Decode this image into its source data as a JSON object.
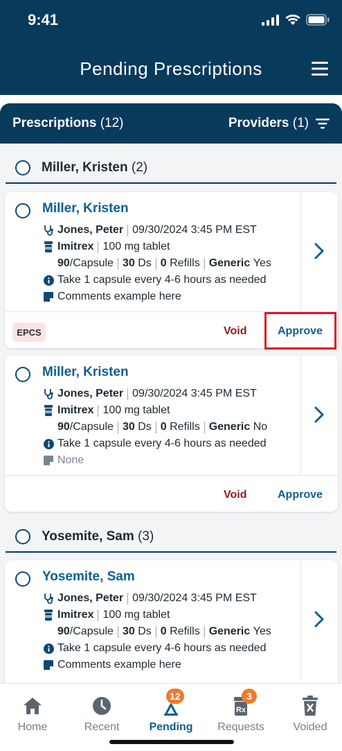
{
  "status": {
    "time": "9:41"
  },
  "header": {
    "title": "Pending Prescriptions",
    "menu_icon": "hamburger-menu-icon"
  },
  "strip": {
    "prescriptions_label": "Prescriptions",
    "prescriptions_count": "(12)",
    "providers_label": "Providers",
    "providers_count": "(1)"
  },
  "groups": [
    {
      "name": "Miller, Kristen",
      "count": "(2)"
    },
    {
      "name": "Yosemite, Sam",
      "count": "(3)"
    }
  ],
  "cards": [
    {
      "patient": "Miller, Kristen",
      "provider": "Jones, Peter",
      "datetime": "09/30/2024 3:45 PM EST",
      "drug": "Imitrex",
      "strength": "100 mg tablet",
      "qty": "90",
      "qty_unit": "/Capsule",
      "days": "30",
      "days_unit": "Ds",
      "refills": "0",
      "refills_unit": "Refills",
      "generic_label": "Generic",
      "generic_value": "Yes",
      "sig": "Take 1 capsule every 4-6 hours as needed",
      "comments": "Comments example here",
      "badge": "EPCS",
      "void_label": "Void",
      "approve_label": "Approve"
    },
    {
      "patient": "Miller, Kristen",
      "provider": "Jones, Peter",
      "datetime": "09/30/2024 3:45 PM EST",
      "drug": "Imitrex",
      "strength": "100 mg tablet",
      "qty": "90",
      "qty_unit": "/Capsule",
      "days": "30",
      "days_unit": "Ds",
      "refills": "0",
      "refills_unit": "Refills",
      "generic_label": "Generic",
      "generic_value": "No",
      "sig": "Take 1 capsule every 4-6 hours as needed",
      "comments": "None",
      "void_label": "Void",
      "approve_label": "Approve"
    },
    {
      "patient": "Yosemite, Sam",
      "provider": "Jones, Peter",
      "datetime": "09/30/2024 3:45 PM EST",
      "drug": "Imitrex",
      "strength": "100 mg tablet",
      "qty": "90",
      "qty_unit": "/Capsule",
      "days": "30",
      "days_unit": "Ds",
      "refills": "0",
      "refills_unit": "Refills",
      "generic_label": "Generic",
      "generic_value": "Yes",
      "sig": "Take 1 capsule every 4-6 hours as needed",
      "comments": "Comments example here"
    }
  ],
  "tabs": [
    {
      "label": "Home",
      "icon": "home-icon"
    },
    {
      "label": "Recent",
      "icon": "clock-icon"
    },
    {
      "label": "Pending",
      "icon": "hourglass-icon",
      "badge": "12"
    },
    {
      "label": "Requests",
      "icon": "prescription-bottle-icon",
      "badge": "3"
    },
    {
      "label": "Voided",
      "icon": "trash-icon"
    }
  ],
  "colors": {
    "brand": "#083a5c",
    "link": "#0e5f93",
    "void": "#8c1c1c",
    "badge": "#f07a2c",
    "highlight": "#e0161e"
  }
}
